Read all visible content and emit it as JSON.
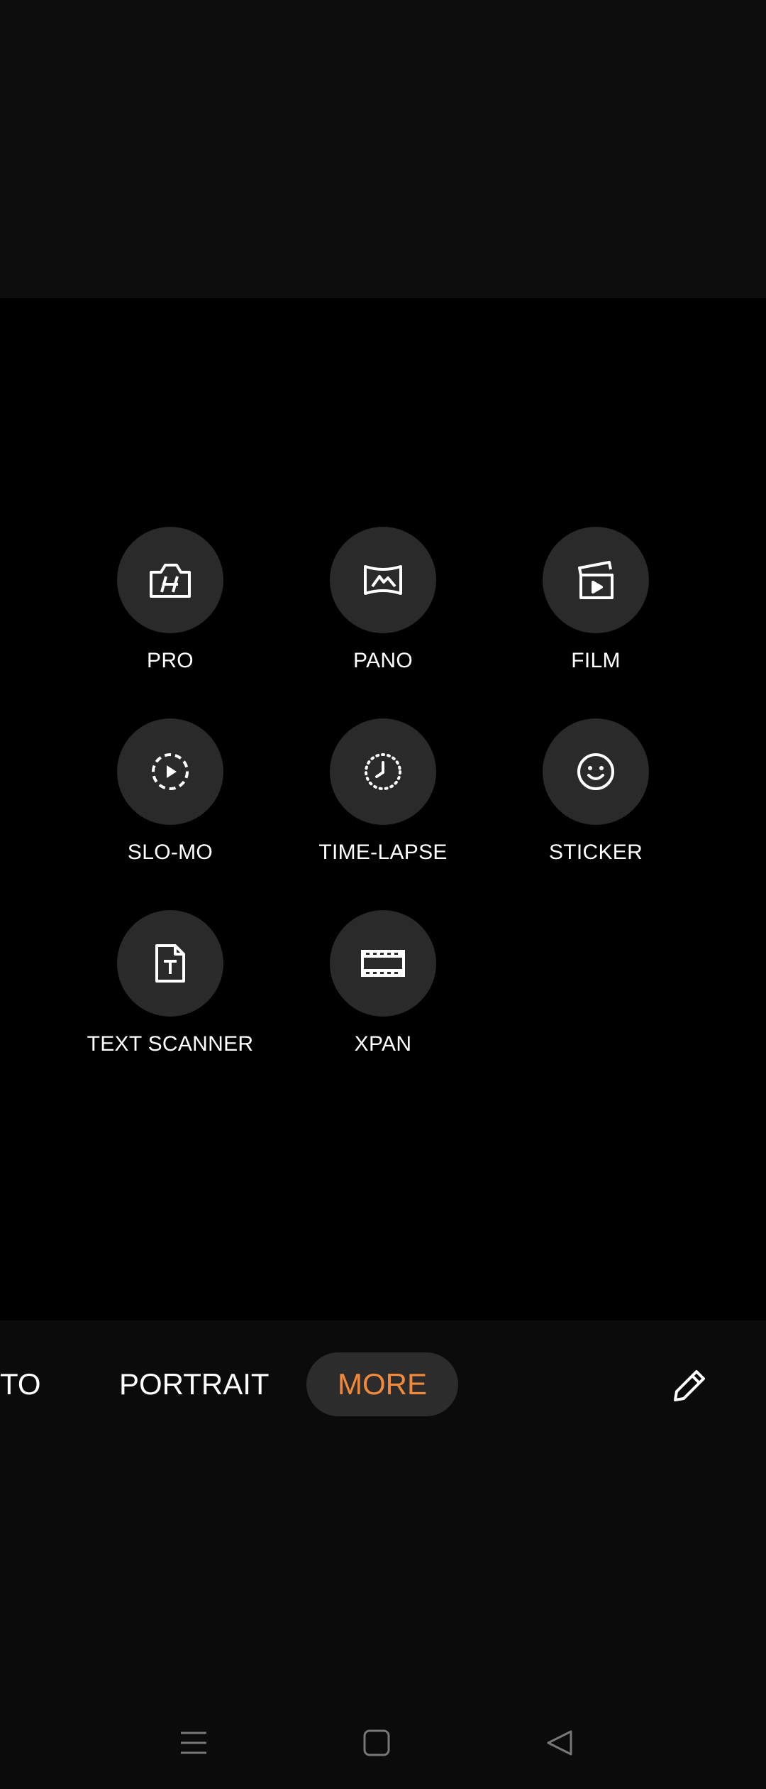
{
  "modes": [
    {
      "label": "PRO",
      "icon": "pro-camera-icon"
    },
    {
      "label": "PANO",
      "icon": "panorama-icon"
    },
    {
      "label": "FILM",
      "icon": "film-clapper-icon"
    },
    {
      "label": "SLO-MO",
      "icon": "slow-motion-icon"
    },
    {
      "label": "TIME-LAPSE",
      "icon": "time-lapse-icon"
    },
    {
      "label": "STICKER",
      "icon": "smiley-sticker-icon"
    },
    {
      "label": "TEXT SCANNER",
      "icon": "text-document-icon"
    },
    {
      "label": "XPAN",
      "icon": "filmstrip-icon"
    }
  ],
  "mode_switcher": {
    "items": [
      "TO",
      "PORTRAIT",
      "MORE"
    ],
    "active": "MORE",
    "active_color": "#f08a3a"
  },
  "toolbar": {
    "edit_icon": "pencil-icon"
  },
  "nav_bar": {
    "menu_icon": "menu-lines-icon",
    "home_icon": "home-square-icon",
    "back_icon": "back-triangle-icon"
  },
  "colors": {
    "background": "#000000",
    "circle": "#2a2a2a",
    "accent": "#f08a3a"
  }
}
